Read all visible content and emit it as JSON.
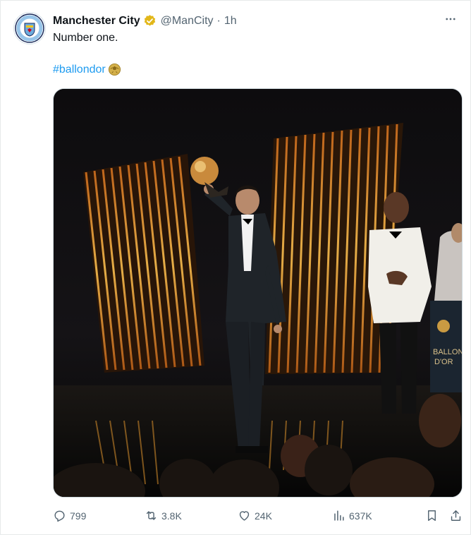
{
  "post": {
    "author": {
      "display_name": "Manchester City",
      "handle": "@ManCity",
      "verified_badge": "gold-verified-badge-icon",
      "avatar": "manchester-city-crest"
    },
    "time": "1h",
    "separator": "·",
    "text": "Number one.",
    "hashtag": "#ballondor",
    "hashtag_emoji": "ballon-dor-emoji",
    "media": {
      "alt_sign_text_line1": "BALLON",
      "alt_sign_text_line2": "D'OR"
    },
    "more_icon": "more-horizontal-icon"
  },
  "actions": {
    "reply_count": "799",
    "repost_count": "3.8K",
    "like_count": "24K",
    "views_count": "637K",
    "icons": [
      "reply-icon",
      "repost-icon",
      "like-icon",
      "views-icon",
      "bookmark-icon",
      "share-icon"
    ]
  },
  "colors": {
    "link": "#1d9bf0",
    "text_primary": "#0f1419",
    "text_secondary": "#536471",
    "verified_gold": "#e2b719"
  }
}
